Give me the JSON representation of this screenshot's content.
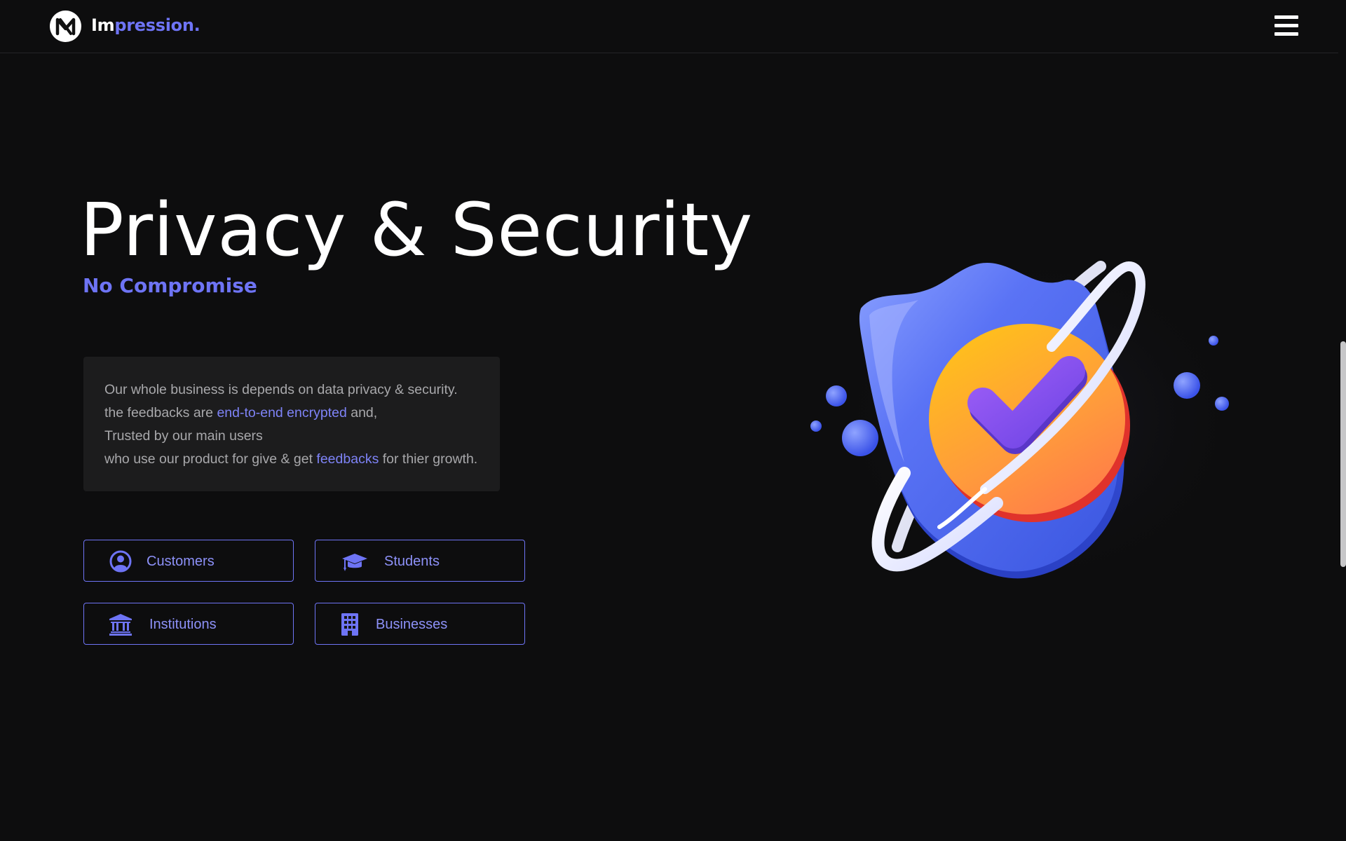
{
  "header": {
    "brand_part1": "Im",
    "brand_part2": "pression.",
    "logo_icon": "monogram-logo-icon",
    "menu_icon": "hamburger-menu-icon"
  },
  "hero": {
    "title": "Privacy & Security",
    "subtitle": "No Compromise"
  },
  "description": {
    "line1": "Our whole business is depends on data privacy & security.",
    "line2_pre": "the feedbacks are ",
    "line2_link": "end-to-end encrypted",
    "line2_post": " and,",
    "line3": "Trusted by our main users",
    "line4_pre": "who use our product for give & get ",
    "line4_link": "feedbacks",
    "line4_post": " for thier growth."
  },
  "audiences": [
    {
      "label": "Customers",
      "icon": "user-circle-icon"
    },
    {
      "label": "Students",
      "icon": "graduation-cap-icon"
    },
    {
      "label": "Institutions",
      "icon": "bank-building-icon"
    },
    {
      "label": "Businesses",
      "icon": "office-building-icon"
    }
  ],
  "illustration": {
    "icon": "security-shield-check-icon"
  },
  "colors": {
    "background": "#0d0d0e",
    "accent": "#6e74f5",
    "card": "#1c1c1d",
    "text_muted": "#a8a8ab",
    "shield_blue": "#4f6af0",
    "badge_orange": "#fca93a",
    "check_purple": "#8a55f0"
  }
}
